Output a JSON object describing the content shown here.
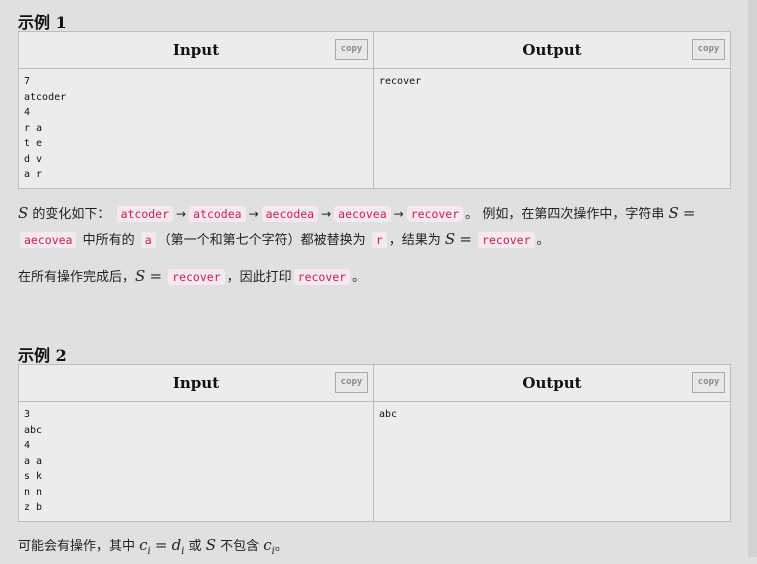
{
  "example1": {
    "title": "示例 1",
    "input_header": "Input",
    "output_header": "Output",
    "copy_label": "copy",
    "input_text": "7\natcoder\n4\nr a\nt e\nd v\na r",
    "output_text": "recover"
  },
  "explanation1": {
    "var_S": "S",
    "text_intro": " 的变化如下：",
    "seq": [
      "atcoder",
      "atcodea",
      "aecodea",
      "aecovea",
      "recover"
    ],
    "arrow": "→",
    "text_period": "。",
    "text_example": "例如，在第四次操作中，字符串",
    "eq": "=",
    "code_before": "aecovea",
    "text_all": " 中所有的 ",
    "code_a": "a",
    "text_replaced": "（第一个和第七个字符）都被替换为",
    "code_r": "r",
    "text_result": "，结果为",
    "code_result": "recover",
    "text_end": "。"
  },
  "explanation2": {
    "text_after": "在所有操作完成后，",
    "var_S": "S",
    "eq": "=",
    "code_final": "recover",
    "text_print": "，因此打印",
    "code_print": "recover",
    "text_end": "。"
  },
  "example2": {
    "title": "示例 2",
    "input_header": "Input",
    "output_header": "Output",
    "copy_label": "copy",
    "input_text": "3\nabc\n4\na a\ns k\nn n\nz b",
    "output_text": "abc"
  },
  "explanation3": {
    "text_may": "可能会有操作，其中 ",
    "var_c": "c",
    "sub_i": "i",
    "eq": "=",
    "var_d": "d",
    "text_or": " 或 ",
    "var_S": "S",
    "text_not_contain": " 不包含 ",
    "text_end": "。"
  }
}
